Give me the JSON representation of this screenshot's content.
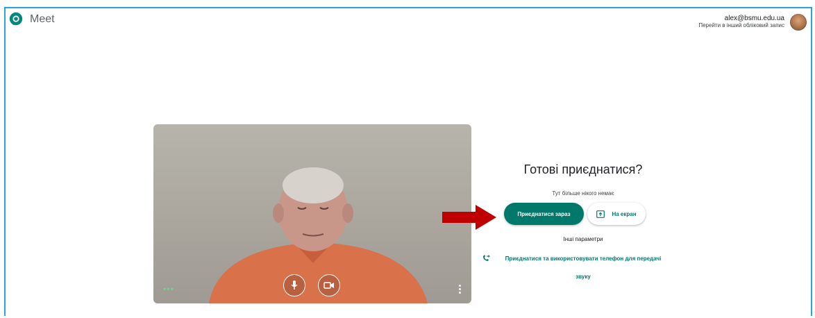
{
  "app": {
    "name": "Meet"
  },
  "account": {
    "email": "alex@bsmu.edu.ua",
    "switch_label": "Перейти в інший обліковий запис"
  },
  "preview": {
    "more_options_left": "•••"
  },
  "join": {
    "title": "Готові приєднатися?",
    "status": "Тут більше нікого немає",
    "join_now_label": "Приєднатися зараз",
    "present_label": "На екран",
    "other_options_label": "Інші параметри",
    "phone_audio_label_line1": "Приєднатися та використовувати телефон для передачі",
    "phone_audio_label_line2": "звуку"
  },
  "colors": {
    "accent": "#00796b",
    "frame": "#29a3dd",
    "arrow": "#c00000"
  }
}
